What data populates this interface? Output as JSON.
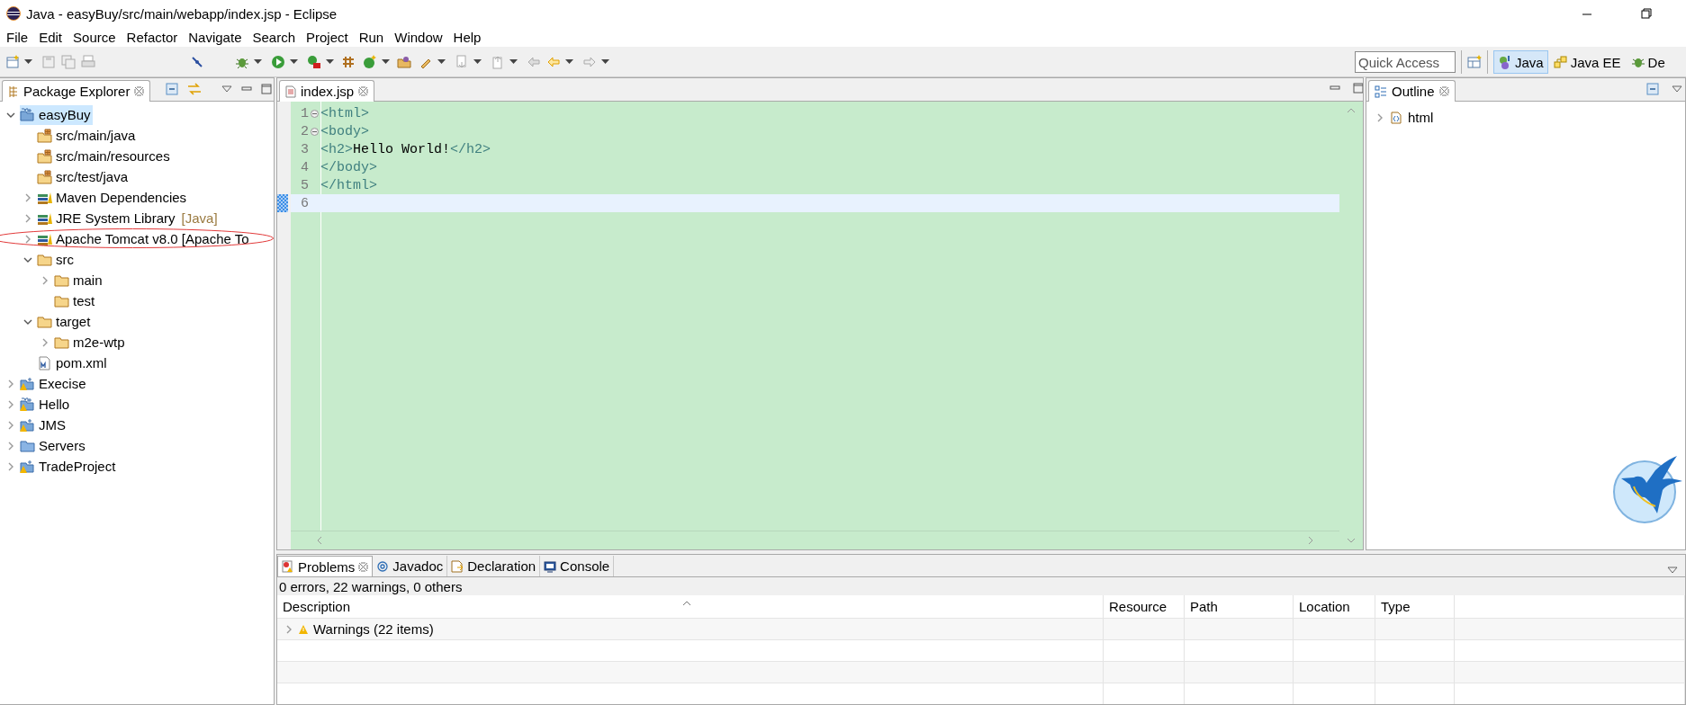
{
  "window": {
    "title": "Java - easyBuy/src/main/webapp/index.jsp - Eclipse"
  },
  "menu": [
    "File",
    "Edit",
    "Source",
    "Refactor",
    "Navigate",
    "Search",
    "Project",
    "Run",
    "Window",
    "Help"
  ],
  "toolbar": {
    "quick_access": {
      "placeholder": "Quick Access"
    },
    "perspectives": [
      {
        "label": "Java",
        "selected": true
      },
      {
        "label": "Java EE",
        "selected": false
      },
      {
        "label": "De",
        "selected": false
      }
    ]
  },
  "package_explorer": {
    "title": "Package Explorer",
    "tree": [
      {
        "label": "easyBuy",
        "kind": "maven-project",
        "expanded": true,
        "selected": true,
        "warning": false,
        "circled": false,
        "children": [
          {
            "label": "src/main/java",
            "kind": "source-folder",
            "selected": false,
            "warning": false,
            "circled": false
          },
          {
            "label": "src/main/resources",
            "kind": "source-folder",
            "selected": false,
            "warning": false,
            "circled": false
          },
          {
            "label": "src/test/java",
            "kind": "source-folder",
            "selected": false,
            "warning": false,
            "circled": false
          },
          {
            "label": "Maven Dependencies",
            "kind": "library",
            "expanded": false,
            "selected": false,
            "warning": false,
            "circled": false
          },
          {
            "label": "JRE System Library",
            "decoration": "[Java]",
            "kind": "library",
            "expanded": false,
            "selected": false,
            "warning": false,
            "circled": false
          },
          {
            "label": "Apache Tomcat v8.0 [Apache To",
            "kind": "library",
            "expanded": false,
            "selected": false,
            "warning": false,
            "circled": true
          },
          {
            "label": "src",
            "kind": "folder",
            "expanded": true,
            "selected": false,
            "warning": false,
            "circled": false,
            "children": [
              {
                "label": "main",
                "kind": "folder",
                "expanded": false,
                "selected": false,
                "warning": false,
                "circled": false
              },
              {
                "label": "test",
                "kind": "folder",
                "selected": false,
                "warning": false,
                "circled": false
              }
            ]
          },
          {
            "label": "target",
            "kind": "folder",
            "expanded": true,
            "selected": false,
            "warning": false,
            "circled": false,
            "children": [
              {
                "label": "m2e-wtp",
                "kind": "folder",
                "expanded": false,
                "selected": false,
                "warning": false,
                "circled": false
              }
            ]
          },
          {
            "label": "pom.xml",
            "kind": "maven-file",
            "selected": false,
            "warning": false,
            "circled": false
          }
        ]
      },
      {
        "label": "Execise",
        "kind": "project",
        "expanded": false,
        "selected": false,
        "warning": true,
        "circled": false
      },
      {
        "label": "Hello",
        "kind": "maven-project",
        "expanded": false,
        "selected": false,
        "warning": true,
        "circled": false
      },
      {
        "label": "JMS",
        "kind": "project",
        "expanded": false,
        "selected": false,
        "warning": true,
        "circled": false
      },
      {
        "label": "Servers",
        "kind": "server-project",
        "expanded": false,
        "selected": false,
        "warning": false,
        "circled": false
      },
      {
        "label": "TradeProject",
        "kind": "project",
        "expanded": false,
        "selected": false,
        "warning": true,
        "circled": false
      }
    ]
  },
  "editor": {
    "tab": "index.jsp",
    "lines": [
      {
        "number": "1",
        "foldable": true,
        "current": false,
        "tokens": [
          {
            "kind": "tag",
            "text": "<html>"
          }
        ]
      },
      {
        "number": "2",
        "foldable": true,
        "current": false,
        "tokens": [
          {
            "kind": "tag",
            "text": "<body>"
          }
        ]
      },
      {
        "number": "3",
        "foldable": false,
        "current": false,
        "tokens": [
          {
            "kind": "tag",
            "text": "<h2>"
          },
          {
            "kind": "text",
            "text": "Hello World!"
          },
          {
            "kind": "tag",
            "text": "</h2>"
          }
        ]
      },
      {
        "number": "4",
        "foldable": false,
        "current": false,
        "tokens": [
          {
            "kind": "tag",
            "text": "</body>"
          }
        ]
      },
      {
        "number": "5",
        "foldable": false,
        "current": false,
        "tokens": [
          {
            "kind": "tag",
            "text": "</html>"
          }
        ]
      },
      {
        "number": "6",
        "foldable": false,
        "current": true
      }
    ]
  },
  "outline": {
    "title": "Outline",
    "items": [
      {
        "label": "html",
        "expanded": false
      }
    ]
  },
  "bottom_panel": {
    "tabs": [
      {
        "label": "Problems",
        "selected": true,
        "kind": "problems"
      },
      {
        "label": "Javadoc",
        "selected": false,
        "kind": "javadoc"
      },
      {
        "label": "Declaration",
        "selected": false,
        "kind": "declaration"
      },
      {
        "label": "Console",
        "selected": false,
        "kind": "console"
      }
    ],
    "summary": "0 errors, 22 warnings, 0 others",
    "columns": [
      "Description",
      "Resource",
      "Path",
      "Location",
      "Type"
    ],
    "rows": [
      {
        "description": "Warnings (22 items)",
        "expanded": false
      }
    ]
  }
}
